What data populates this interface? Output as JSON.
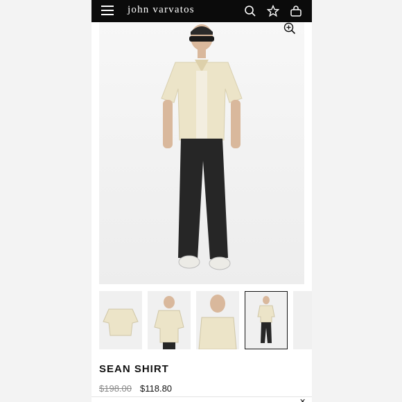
{
  "header": {
    "brand": "john varvatos",
    "menu_icon": "hamburger-menu-icon",
    "search_icon": "search-icon",
    "wishlist_icon": "star-icon",
    "bag_icon": "bag-icon",
    "background": "#0b0b0b"
  },
  "product": {
    "name": "SEAN SHIRT",
    "original_price": "$198.00",
    "sale_price": "$118.80",
    "zoom_icon": "zoom-in-icon",
    "selected_thumbnail": 4,
    "thumbnail_count": 5
  },
  "footer": {
    "close_label": "✕"
  }
}
